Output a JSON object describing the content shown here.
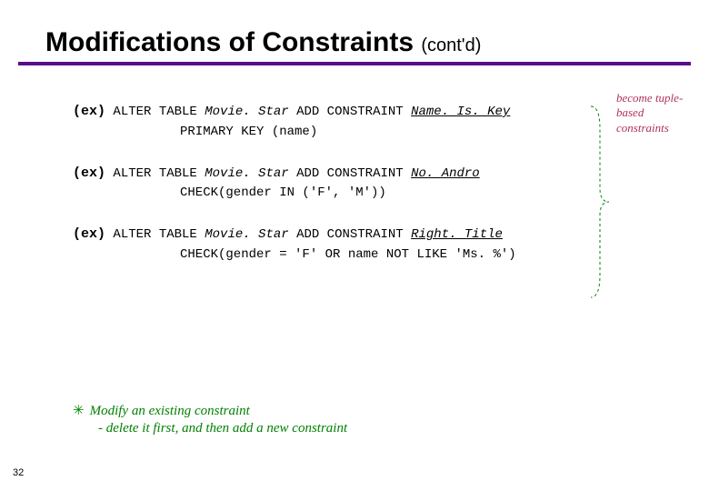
{
  "title": {
    "main": "Modifications of Constraints",
    "sub": "(cont'd)"
  },
  "examples": [
    {
      "label": "(ex)",
      "prefix": "ALTER TABLE ",
      "table": "Movie. Star",
      "mid": " ADD CONSTRAINT ",
      "cname": "Name. Is. Key",
      "line2": "PRIMARY KEY (name)"
    },
    {
      "label": "(ex)",
      "prefix": "ALTER TABLE ",
      "table": "Movie. Star",
      "mid": " ADD CONSTRAINT ",
      "cname": "No. Andro",
      "line2": "CHECK(gender IN ('F', 'M'))"
    },
    {
      "label": "(ex)",
      "prefix": "ALTER TABLE ",
      "table": "Movie. Star",
      "mid": " ADD CONSTRAINT ",
      "cname": "Right. Title",
      "line2": "CHECK(gender = 'F' OR name NOT LIKE 'Ms. %')"
    }
  ],
  "annotation": "become tuple-based constraints",
  "footer": {
    "line1": "Modify an existing constraint",
    "line2": "- delete it first, and then add a new constraint"
  },
  "page": "32"
}
